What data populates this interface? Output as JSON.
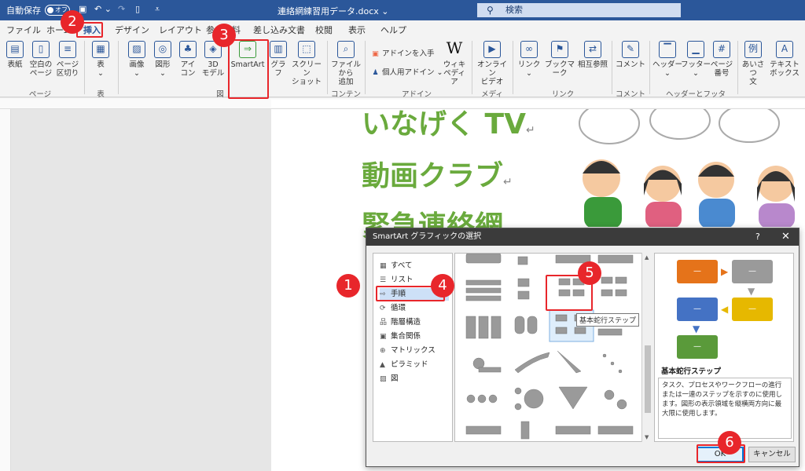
{
  "titlebar": {
    "autosave_label": "自動保存",
    "autosave_state": "オフ",
    "doc_title": "連絡網練習用データ.docx",
    "doc_title_suffix": "⌄",
    "search_placeholder": "検索"
  },
  "tabs": [
    "ファイル",
    "ホーム",
    "挿入",
    "デザイン",
    "レイアウト",
    "参考資料",
    "差し込み文書",
    "校閲",
    "表示",
    "ヘルプ"
  ],
  "ribbon": {
    "buttons": {
      "hyoshi": "表紙",
      "kuhaku": "空白の\nページ",
      "page_break": "ページ\n区切り",
      "table": "表",
      "image": "画像",
      "shape": "図形",
      "icon": "アイ\nコン",
      "model3d": "3D\nモデル",
      "smartart": "SmartArt",
      "graph": "グラフ",
      "screenshot": "スクリーン\nショット",
      "file_add": "ファイルから\n追加",
      "addin_get": "アドインを入手",
      "my_addin": "個人用アドイン",
      "wiki": "ウィキ\nペディア",
      "online_video": "オンライン\nビデオ",
      "link": "リンク",
      "bookmark": "ブックマーク",
      "cross_ref": "相互参照",
      "comment": "コメント",
      "header": "ヘッダー",
      "footer": "フッター",
      "page_num": "ページ\n番号",
      "greeting": "あいさつ\n文",
      "textbox": "テキスト\nボックス"
    },
    "groups": {
      "page": "ページ",
      "table": "表",
      "figure": "図",
      "content": "コンテンツ",
      "addin": "アドイン",
      "media": "メディア",
      "link": "リンク",
      "comment": "コメント",
      "header_footer": "ヘッダーとフッター"
    }
  },
  "document": {
    "line1": "いなげく TV",
    "line2": "動画クラブ",
    "line3": "緊急連絡網"
  },
  "dialog": {
    "title": "SmartArt グラフィックの選択",
    "help": "?",
    "close": "✕",
    "categories": [
      {
        "icon": "▦",
        "label": "すべて"
      },
      {
        "icon": "☰",
        "label": "リスト"
      },
      {
        "icon": "⇨",
        "label": "手順"
      },
      {
        "icon": "⟳",
        "label": "循環"
      },
      {
        "icon": "品",
        "label": "階層構造"
      },
      {
        "icon": "▣",
        "label": "集合関係"
      },
      {
        "icon": "⊕",
        "label": "マトリックス"
      },
      {
        "icon": "▲",
        "label": "ピラミッド"
      },
      {
        "icon": "▨",
        "label": "図"
      }
    ],
    "selected_category": "手順",
    "tooltip": "基本蛇行ステップ",
    "preview": {
      "box_text": "—",
      "colors": [
        "#e5731a",
        "#9a9a9a",
        "#4472c4",
        "#e6b800",
        "#5a9a3a"
      ],
      "name": "基本蛇行ステップ",
      "description": "タスク、プロセスやワークフローの進行または一連のステップを示すのに使用します。図形の表示領域を縦横両方向に最大限に使用します。"
    },
    "ok": "OK",
    "cancel": "キャンセル"
  },
  "markers": [
    "1",
    "2",
    "3",
    "4",
    "5",
    "6"
  ],
  "colors": {
    "accent": "#2b579a",
    "highlight": "#e8262b",
    "doc_green": "#6aaa3d"
  }
}
